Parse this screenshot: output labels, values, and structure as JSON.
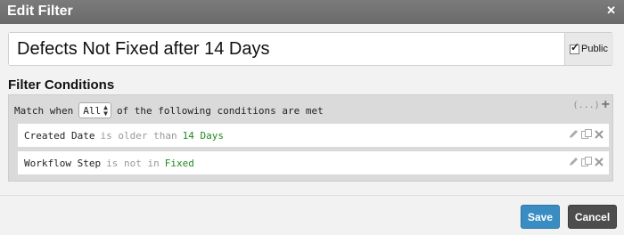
{
  "dialog": {
    "title": "Edit Filter",
    "close_icon": "close-icon"
  },
  "filter": {
    "name": "Defects Not Fixed after 14 Days",
    "public_label": "Public",
    "public_checked": true
  },
  "conditions": {
    "section_title": "Filter Conditions",
    "match_prefix": "Match when",
    "match_value": "All",
    "match_suffix": "of the following conditions are met",
    "more_label": "(...)",
    "add_icon": "plus-icon",
    "rows": [
      {
        "field": "Created Date",
        "operator": "is older than",
        "value": "14 Days"
      },
      {
        "field": "Workflow Step",
        "operator": "is not in",
        "value": "Fixed"
      }
    ]
  },
  "actions": {
    "save_label": "Save",
    "cancel_label": "Cancel"
  },
  "colors": {
    "save_button": "#3a8dc2",
    "cancel_button": "#4d4d4d",
    "condition_value": "#1f8a1f",
    "titlebar": "#6f6f6f"
  }
}
